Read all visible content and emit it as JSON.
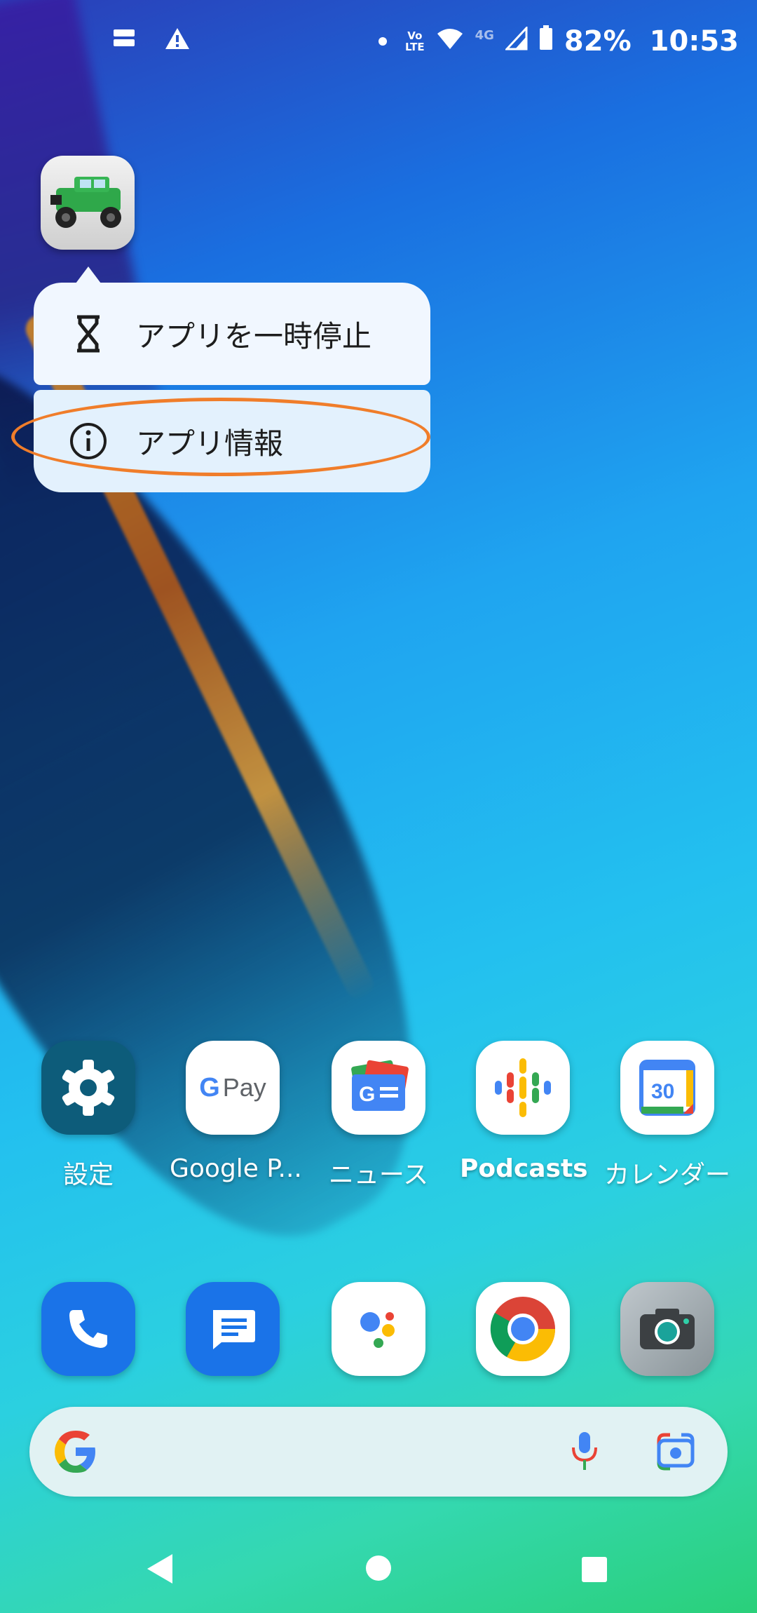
{
  "status_bar": {
    "battery": "82%",
    "time": "10:53",
    "volte_top": "Vo",
    "volte_bottom": "LTE",
    "network": "4G"
  },
  "popup": {
    "items": [
      {
        "label": "アプリを一時停止",
        "icon": "hourglass-icon"
      },
      {
        "label": "アプリ情報",
        "icon": "info-icon"
      }
    ],
    "highlight_color": "#f07d2a"
  },
  "apps": [
    {
      "label": "設定",
      "icon": "settings-icon"
    },
    {
      "label": "Google P...",
      "icon": "google-pay-icon",
      "icon_text": "Pay"
    },
    {
      "label": "ニュース",
      "icon": "google-news-icon"
    },
    {
      "label": "Podcasts",
      "icon": "podcasts-icon"
    },
    {
      "label": "カレンダー",
      "icon": "calendar-icon",
      "icon_text": "30"
    }
  ],
  "dock": [
    {
      "icon": "phone-icon"
    },
    {
      "icon": "messages-icon"
    },
    {
      "icon": "assistant-icon"
    },
    {
      "icon": "chrome-icon"
    },
    {
      "icon": "camera-icon"
    }
  ],
  "search_bar": {
    "icon": "google-g-icon"
  },
  "nav": {
    "back": "back-icon",
    "home": "home-icon",
    "recents": "recents-icon"
  }
}
